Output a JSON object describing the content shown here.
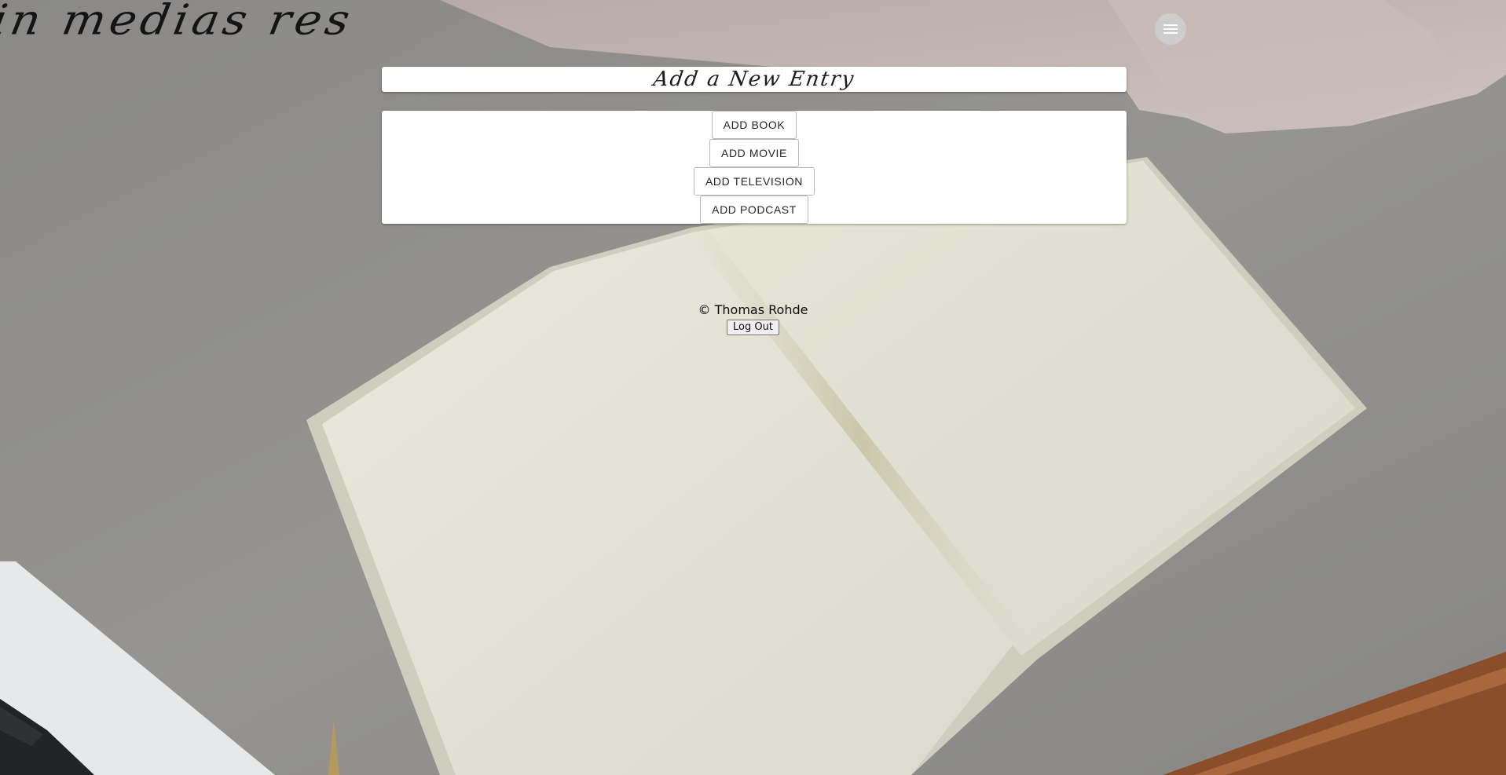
{
  "site": {
    "title": "in medias res"
  },
  "menu": {
    "icon": "hamburger-menu-icon"
  },
  "entry": {
    "heading": "Add a New Entry",
    "buttons": {
      "book": "ADD BOOK",
      "movie": "ADD MOVIE",
      "television": "ADD TELEVISION",
      "podcast": "ADD PODCAST"
    }
  },
  "footer": {
    "copyright": "© Thomas Rohde",
    "logout_label": "Log Out"
  },
  "colors": {
    "card_background": "#ffffff",
    "menu_button": "#cdcdcf",
    "title_text": "#141414"
  }
}
